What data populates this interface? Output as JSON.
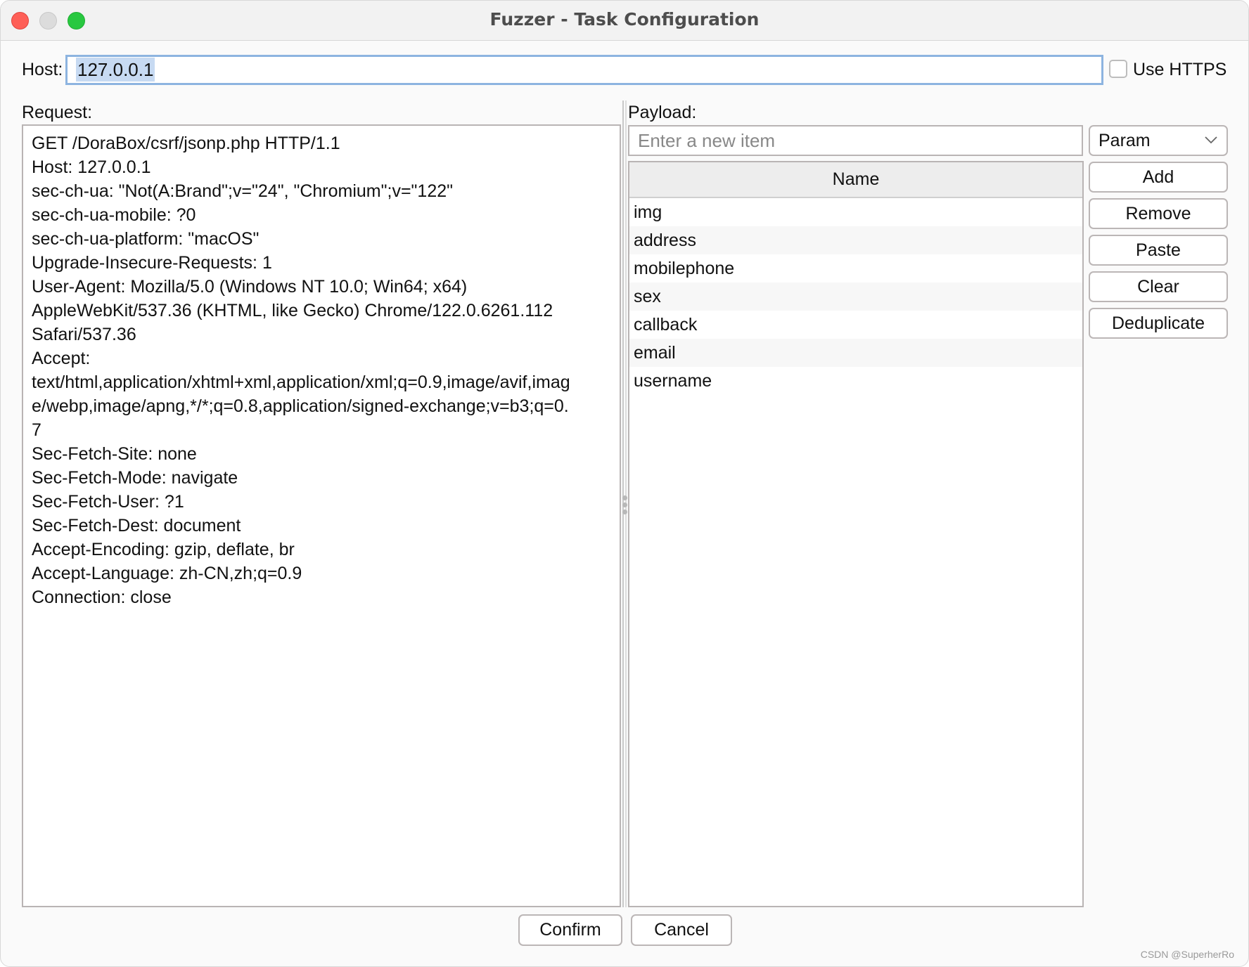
{
  "window": {
    "title": "Fuzzer - Task Configuration"
  },
  "host": {
    "label": "Host:",
    "value": "127.0.0.1",
    "use_https_label": "Use HTTPS",
    "use_https_checked": false
  },
  "request": {
    "label": "Request:",
    "lines": [
      "GET /DoraBox/csrf/jsonp.php HTTP/1.1",
      "Host: 127.0.0.1",
      "sec-ch-ua: \"Not(A:Brand\";v=\"24\", \"Chromium\";v=\"122\"",
      "sec-ch-ua-mobile: ?0",
      "sec-ch-ua-platform: \"macOS\"",
      "Upgrade-Insecure-Requests: 1",
      "User-Agent: Mozilla/5.0 (Windows NT 10.0; Win64; x64)",
      "AppleWebKit/537.36 (KHTML, like Gecko) Chrome/122.0.6261.112",
      "Safari/537.36",
      "Accept:",
      "text/html,application/xhtml+xml,application/xml;q=0.9,image/avif,imag",
      "e/webp,image/apng,*/*;q=0.8,application/signed-exchange;v=b3;q=0.",
      "7",
      "Sec-Fetch-Site: none",
      "Sec-Fetch-Mode: navigate",
      "Sec-Fetch-User: ?1",
      "Sec-Fetch-Dest: document",
      "Accept-Encoding: gzip, deflate, br",
      "Accept-Language: zh-CN,zh;q=0.9",
      "Connection: close"
    ]
  },
  "payload": {
    "label": "Payload:",
    "new_item_placeholder": "Enter a new item",
    "new_item_value": "",
    "type_selected": "Param",
    "table": {
      "column_header": "Name",
      "rows": [
        "img",
        "address",
        "mobilephone",
        "sex",
        "callback",
        "email",
        "username"
      ]
    },
    "buttons": {
      "add": "Add",
      "remove": "Remove",
      "paste": "Paste",
      "clear": "Clear",
      "deduplicate": "Deduplicate"
    }
  },
  "footer": {
    "confirm": "Confirm",
    "cancel": "Cancel"
  },
  "watermark": "CSDN @SuperherRo",
  "icons": {
    "close": "traffic-light-close",
    "minimize": "traffic-light-minimize",
    "maximize": "traffic-light-maximize",
    "dropdown": "chevron-down-icon",
    "splitter": "splitter-grip-icon"
  },
  "colors": {
    "close": "#fe5f57",
    "minimize": "#dcdcdc",
    "maximize": "#28c840",
    "focus_ring": "#8db4e0",
    "selection": "#c7daf2"
  }
}
